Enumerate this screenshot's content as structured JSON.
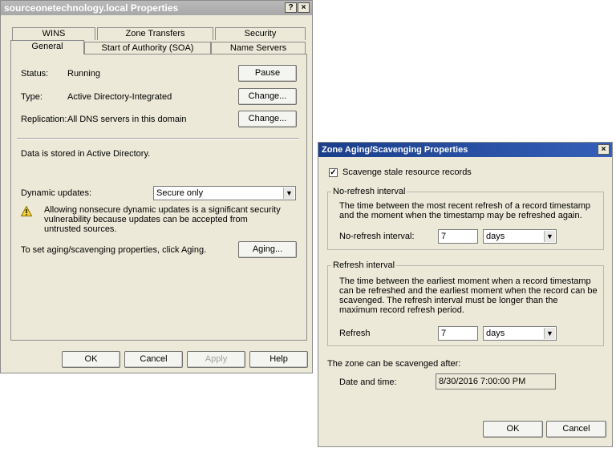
{
  "props": {
    "title": "sourceonetechnology.local Properties",
    "help_btn": "?",
    "close_btn": "×",
    "tabs_back": [
      "WINS",
      "Zone Transfers",
      "Security"
    ],
    "tabs_front": [
      "General",
      "Start of Authority (SOA)",
      "Name Servers"
    ],
    "status_label": "Status:",
    "status_value": "Running",
    "pause_btn": "Pause",
    "type_label": "Type:",
    "type_value": "Active Directory-Integrated",
    "change_btn": "Change...",
    "replication_label": "Replication:",
    "replication_value": "All DNS servers in this domain",
    "stored_text": "Data is stored in Active Directory.",
    "dyn_label": "Dynamic updates:",
    "dyn_value": "Secure only",
    "warning_text": "Allowing nonsecure dynamic updates is a significant security vulnerability because updates can be accepted from untrusted sources.",
    "aging_text": "To set aging/scavenging properties, click Aging.",
    "aging_btn": "Aging...",
    "ok_btn": "OK",
    "cancel_btn": "Cancel",
    "apply_btn": "Apply",
    "help_button": "Help"
  },
  "zone": {
    "title": "Zone Aging/Scavenging Properties",
    "close_btn": "×",
    "scavenge_label": "Scavenge stale resource records",
    "scavenge_checked": true,
    "norefresh_group": "No-refresh interval",
    "norefresh_desc": "The time between the most recent refresh of a record timestamp and the moment when the timestamp may be refreshed again.",
    "norefresh_label": "No-refresh interval:",
    "norefresh_value": "7",
    "norefresh_unit": "days",
    "refresh_group": "Refresh interval",
    "refresh_desc": "The time between the earliest moment when a record timestamp can be refreshed and the earliest moment when the record can be scavenged. The refresh interval must be longer than the maximum record refresh period.",
    "refresh_label": "Refresh",
    "refresh_value": "7",
    "refresh_unit": "days",
    "scavenged_after": "The zone can be scavenged after:",
    "date_label": "Date and time:",
    "date_value": "8/30/2016 7:00:00 PM",
    "ok_btn": "OK",
    "cancel_btn": "Cancel"
  }
}
